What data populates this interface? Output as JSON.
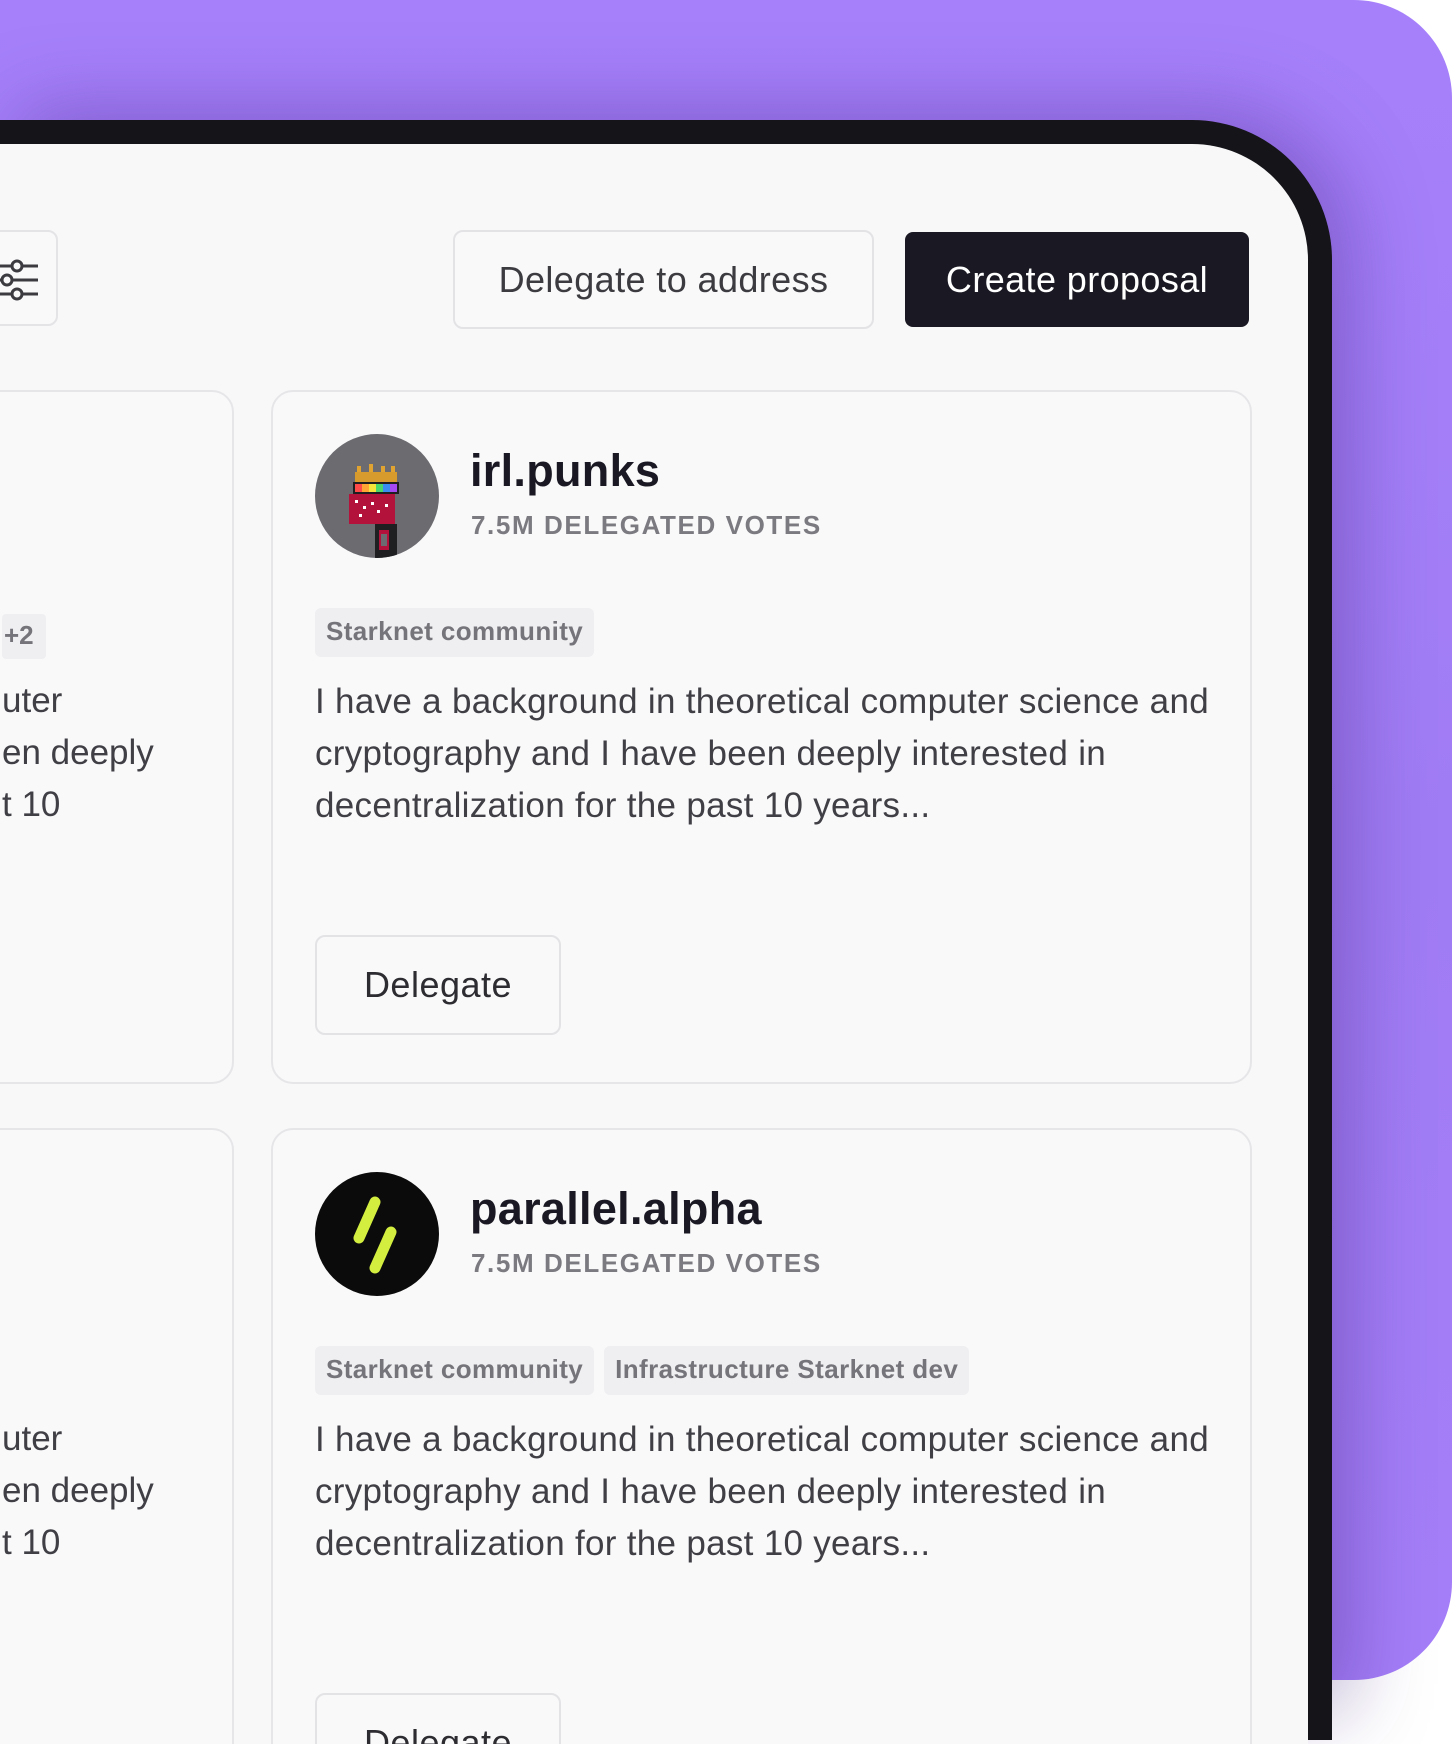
{
  "toolbar": {
    "filter_icon": "sliders-icon",
    "delegate_to_address_label": "Delegate to address",
    "create_proposal_label": "Create proposal"
  },
  "partial_cards": [
    {
      "badge": "+2",
      "lines": [
        "uter",
        "en deeply",
        "t 10"
      ]
    },
    {
      "lines": [
        "uter",
        "en deeply",
        "t 10"
      ]
    }
  ],
  "delegates": [
    {
      "name": "irl.punks",
      "votes": "7.5M DELEGATED VOTES",
      "avatar_icon": "pixel-punk-avatar",
      "tags": [
        "Starknet community"
      ],
      "bio": "I have a background in theoretical computer science and cryptography and I have been deeply interested in decentralization for the past 10 years...",
      "action_label": "Delegate"
    },
    {
      "name": "parallel.alpha",
      "votes": "7.5M DELEGATED VOTES",
      "avatar_icon": "parallel-logo-avatar",
      "tags": [
        "Starknet community",
        "Infrastructure Starknet dev"
      ],
      "bio": "I have a background in theoretical computer science and cryptography and I have been deeply interested in decentralization for the past 10 years...",
      "action_label": "Delegate"
    }
  ],
  "colors": {
    "background_purple": "#a680fb",
    "device_frame": "#151418",
    "screen": "#f8f8f9",
    "primary_button": "#1a1923",
    "parallel_accent": "#d4ee3f"
  }
}
